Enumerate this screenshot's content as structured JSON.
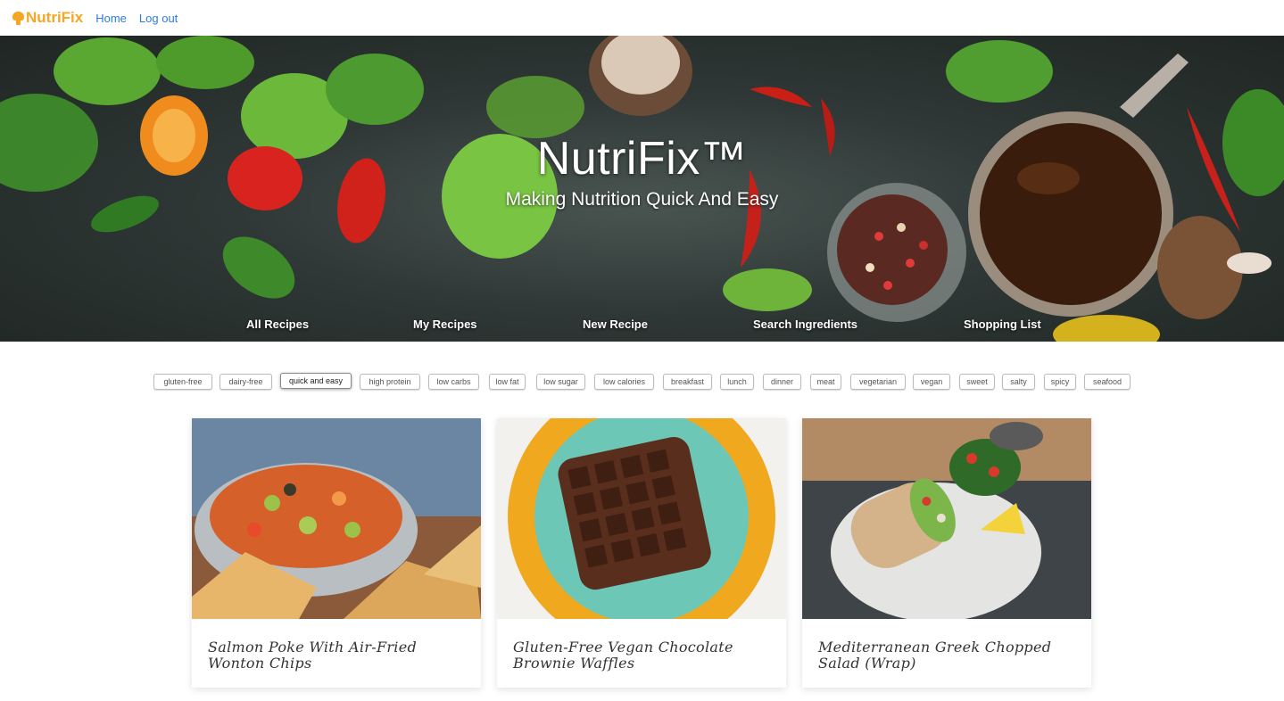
{
  "nav": {
    "brand": "NutriFix",
    "links": [
      "Home",
      "Log out"
    ]
  },
  "hero": {
    "title": "NutriFix™",
    "subtitle": "Making Nutrition Quick And Easy",
    "menu": [
      "All Recipes",
      "My Recipes",
      "New Recipe",
      "Search Ingredients",
      "Shopping List"
    ]
  },
  "tags": {
    "items": [
      "gluten-free",
      "dairy-free",
      "quick and easy",
      "high protein",
      "low carbs",
      "low fat",
      "low sugar",
      "low calories",
      "breakfast",
      "lunch",
      "dinner",
      "meat",
      "vegetarian",
      "vegan",
      "sweet",
      "salty",
      "spicy",
      "seafood"
    ],
    "selected": "quick and easy"
  },
  "recipes": [
    {
      "title": "Salmon Poke With Air-Fried Wonton Chips"
    },
    {
      "title": "Gluten-Free Vegan Chocolate Brownie Waffles"
    },
    {
      "title": "Mediterranean Greek Chopped Salad (Wrap)"
    }
  ],
  "colors": {
    "brand": "#f5a623",
    "link": "#2c7be5"
  }
}
